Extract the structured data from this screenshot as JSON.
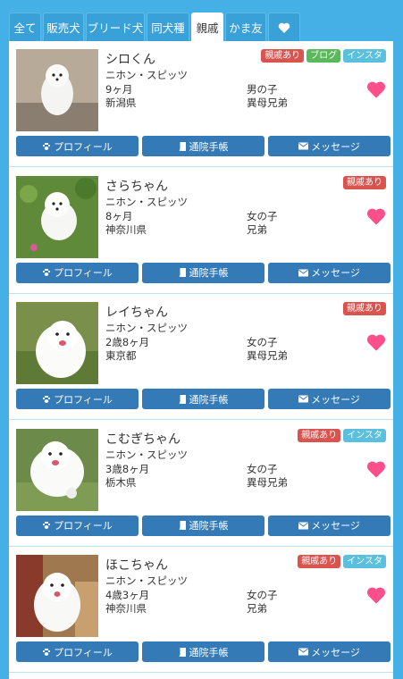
{
  "tabs": [
    {
      "label": "全て",
      "active": false
    },
    {
      "label": "販売犬",
      "active": false
    },
    {
      "label": "ブリード犬",
      "active": false
    },
    {
      "label": "同犬種",
      "active": false
    },
    {
      "label": "親戚",
      "active": true
    },
    {
      "label": "かま友",
      "active": false
    },
    {
      "label": "",
      "icon": "heart-icon",
      "active": false
    }
  ],
  "colors": {
    "badge_red": "#d9534f",
    "badge_green": "#5cb85c",
    "badge_cyan": "#5bc0de",
    "heart": "#ff4f8b",
    "button": "#337ab7",
    "accent": "#45b0e5"
  },
  "buttons": {
    "profile": "プロフィール",
    "notebook": "通院手帳",
    "message": "メッセージ"
  },
  "dogs": [
    {
      "name": "シロくん",
      "breed": "ニホン・スピッツ",
      "age": "9ヶ月",
      "sex": "男の子",
      "location": "新潟県",
      "relation": "異母兄弟",
      "badges": [
        {
          "text": "親戚あり",
          "color": "#d9534f"
        },
        {
          "text": "ブログ",
          "color": "#5cb85c"
        },
        {
          "text": "インスタ",
          "color": "#5bc0de"
        }
      ]
    },
    {
      "name": "さらちゃん",
      "breed": "ニホン・スピッツ",
      "age": "8ヶ月",
      "sex": "女の子",
      "location": "神奈川県",
      "relation": "兄弟",
      "badges": [
        {
          "text": "親戚あり",
          "color": "#d9534f"
        }
      ]
    },
    {
      "name": "レイちゃん",
      "breed": "ニホン・スピッツ",
      "age": "2歳8ヶ月",
      "sex": "女の子",
      "location": "東京都",
      "relation": "異母兄弟",
      "badges": [
        {
          "text": "親戚あり",
          "color": "#d9534f"
        }
      ]
    },
    {
      "name": "こむぎちゃん",
      "breed": "ニホン・スピッツ",
      "age": "3歳8ヶ月",
      "sex": "女の子",
      "location": "栃木県",
      "relation": "異母兄弟",
      "badges": [
        {
          "text": "親戚あり",
          "color": "#d9534f"
        },
        {
          "text": "インスタ",
          "color": "#5bc0de"
        }
      ]
    },
    {
      "name": "ほこちゃん",
      "breed": "ニホン・スピッツ",
      "age": "4歳3ヶ月",
      "sex": "女の子",
      "location": "神奈川県",
      "relation": "兄弟",
      "badges": [
        {
          "text": "親戚あり",
          "color": "#d9534f"
        },
        {
          "text": "インスタ",
          "color": "#5bc0de"
        }
      ]
    }
  ]
}
